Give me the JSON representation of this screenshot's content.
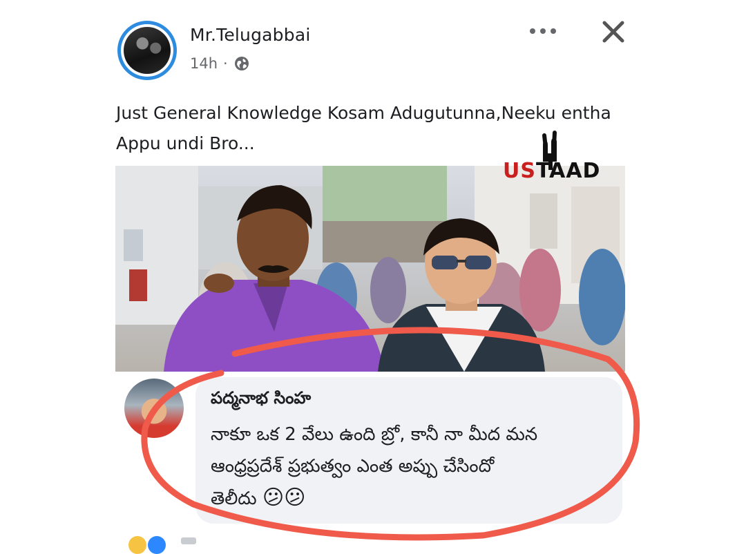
{
  "post": {
    "author": "Mr.Telugabbai",
    "time": "14h",
    "separator": "·",
    "privacy_icon": "globe-icon",
    "more_icon": "more-icon",
    "close_icon": "close-icon",
    "caption": "Just General Knowledge Kosam Adugutunna,Neeku entha Appu undi Bro..."
  },
  "image": {
    "logo_text_a": "US",
    "logo_text_b": "TAAD"
  },
  "comment": {
    "name": "పద్మనాభ సింహ",
    "line1": "నాకూ ఒక 2 వేలు ఉంది బ్రో, కానీ నా మీద మన",
    "line2": "ఆంధ్రప్రదేశ్ ప్రభుత్వం ఎంత అప్పు చేసిందో",
    "line3": "తెలీదు",
    "emojis": "😕😕"
  },
  "colors": {
    "accent_ring": "#2d8ce0",
    "highlight_ellipse": "#ef5a4a",
    "bubble": "#f0f2f5"
  }
}
